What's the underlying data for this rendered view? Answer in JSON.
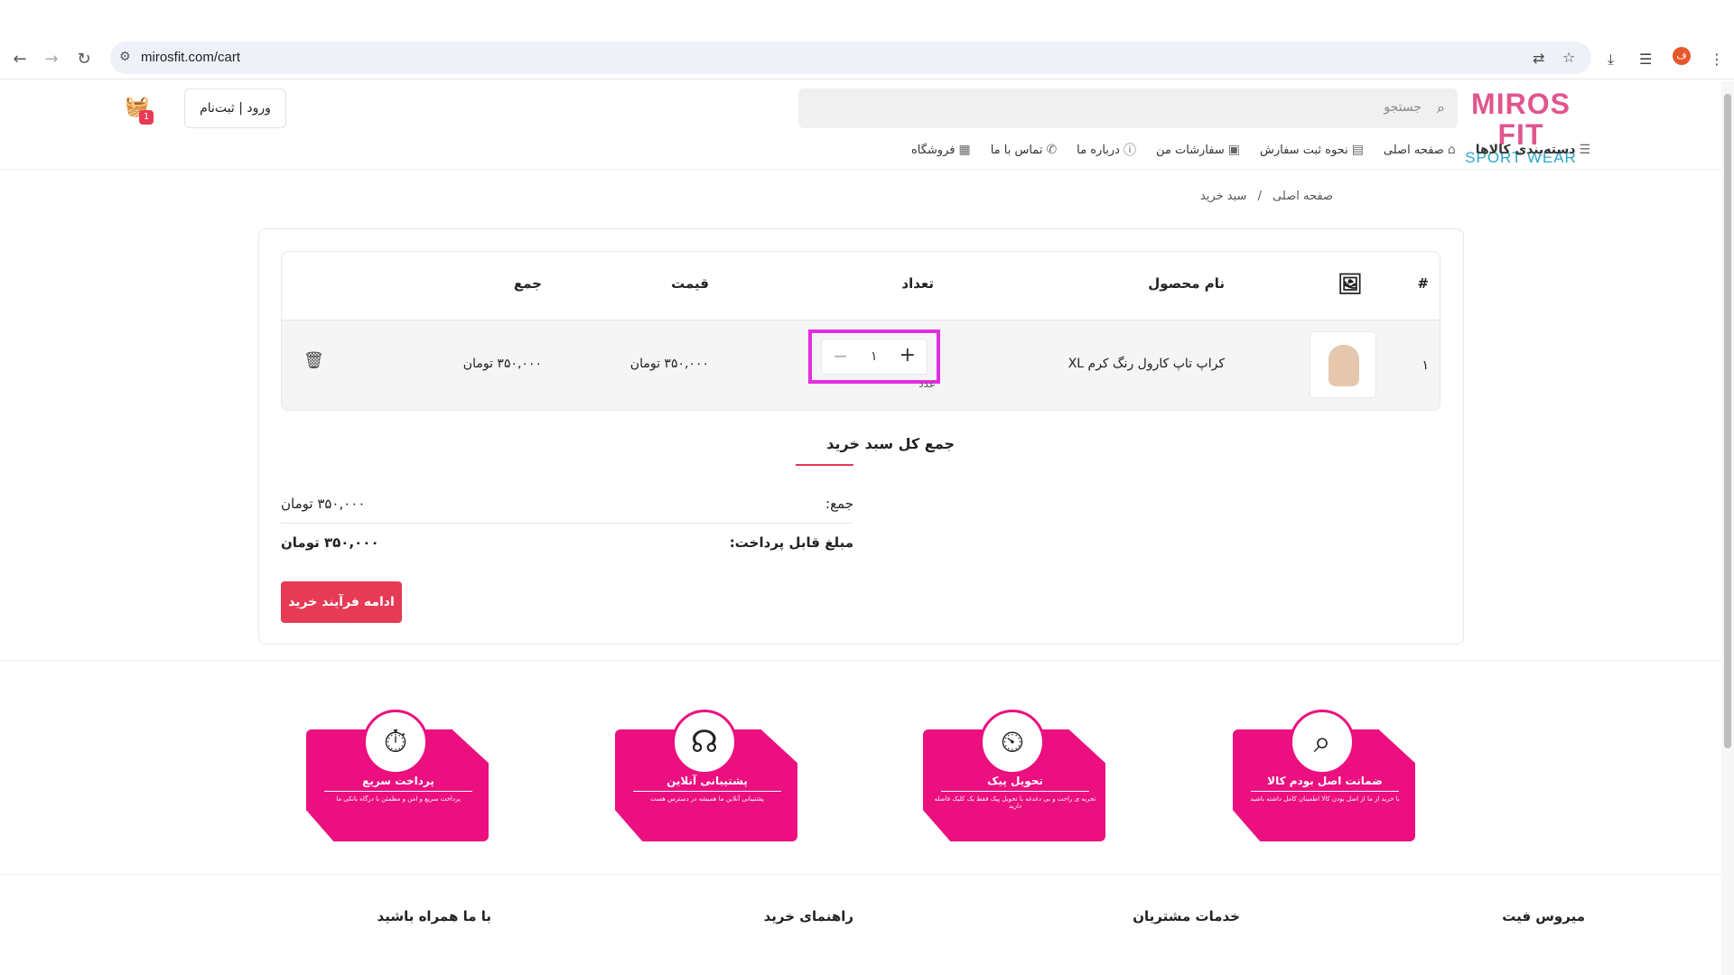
{
  "browser": {
    "url": "mirosfit.com/cart",
    "avatar_letter": "ف"
  },
  "header": {
    "logo_top": "MIROS FIT",
    "logo_bottom": "SPORT WEAR",
    "search_placeholder": "جستجو",
    "login_label": "ورود | ثبت‌نام",
    "cart_count": "1",
    "menu": {
      "categories": "دسته‌بندی کالاها",
      "home": "صفحه اصلی",
      "how_to_order": "نحوه ثبت سفارش",
      "my_orders": "سفارشات من",
      "about": "درباره ما",
      "contact": "تماس با ما",
      "store": "فروشگاه"
    }
  },
  "breadcrumb": {
    "home": "صفحه اصلی",
    "separator": "/",
    "current": "سبد خرید"
  },
  "cart_table": {
    "headers": {
      "index": "#",
      "product_name": "نام محصول",
      "quantity": "تعداد",
      "price": "قیمت",
      "total": "جمع"
    },
    "rows": [
      {
        "index": "۱",
        "product_name": "کراپ تاپ کارول رنگ کرم XL",
        "quantity": "۱",
        "unit": "عدد",
        "price": "۳۵۰,۰۰۰ تومان",
        "total": "۳۵۰,۰۰۰ تومان"
      }
    ]
  },
  "summary": {
    "title": "جمع کل سبد خرید",
    "subtotal_label": "جمع:",
    "subtotal_value": "۳۵۰,۰۰۰ تومان",
    "payable_label": "مبلغ قابل پرداخت:",
    "payable_value": "۳۵۰,۰۰۰ تومان",
    "continue_label": "ادامه فرآیند خرید"
  },
  "features": [
    {
      "title": "ضمانت اصل بودم کالا",
      "desc": "با خرید از ما از اصل بودن کالا اطمینان کامل داشته باشید",
      "icon": "box-search-icon"
    },
    {
      "title": "تحویل پیک",
      "desc": "تجربه ی راحت و بی دغدغه با تحویل پیک فقط یک کلیک فاصله دارید",
      "icon": "box-clock-icon"
    },
    {
      "title": "پشتیبانی آنلاین",
      "desc": "پشتیبانی آنلاین ما همیشه در دسترس هست",
      "icon": "headset-icon"
    },
    {
      "title": "پرداخت سریع",
      "desc": "پرداخت سریع و امن و مطمئن با درگاه بانکی ما",
      "icon": "stopwatch-icon"
    }
  ],
  "footer": {
    "col1": "میروس فیت",
    "col2": "خدمات مشتریان",
    "col3": "راهنمای خرید",
    "col4": "با ما همراه باشید"
  },
  "colors": {
    "accent": "#e63a55",
    "feature_pink": "#ec0f7f",
    "highlight": "#e12de0"
  }
}
